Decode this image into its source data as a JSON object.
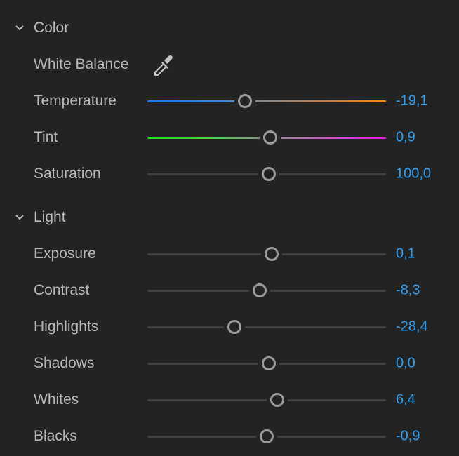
{
  "sections": [
    {
      "title": "Color",
      "icon": "chevron-down-icon",
      "white_balance": {
        "label": "White Balance",
        "icon": "eyedropper-icon"
      },
      "sliders": [
        {
          "label": "Temperature",
          "value": "-19,1",
          "position": 0.41,
          "track": "temperature-gradient"
        },
        {
          "label": "Tint",
          "value": "0,9",
          "position": 0.515,
          "track": "tint-gradient"
        },
        {
          "label": "Saturation",
          "value": "100,0",
          "position": 0.51,
          "track": "neutral"
        }
      ]
    },
    {
      "title": "Light",
      "icon": "chevron-down-icon",
      "sliders": [
        {
          "label": "Exposure",
          "value": "0,1",
          "position": 0.52,
          "track": "neutral"
        },
        {
          "label": "Contrast",
          "value": "-8,3",
          "position": 0.47,
          "track": "neutral"
        },
        {
          "label": "Highlights",
          "value": "-28,4",
          "position": 0.365,
          "track": "neutral"
        },
        {
          "label": "Shadows",
          "value": "0,0",
          "position": 0.51,
          "track": "neutral"
        },
        {
          "label": "Whites",
          "value": "6,4",
          "position": 0.545,
          "track": "neutral"
        },
        {
          "label": "Blacks",
          "value": "-0,9",
          "position": 0.5,
          "track": "neutral"
        }
      ]
    }
  ],
  "colors": {
    "background": "#232323",
    "value_text": "#2f9ff2",
    "label_text": "#b7b7b7",
    "knob": "#9a9a9a",
    "neutral_track": "#3f3f3f",
    "temperature_start": "#1e78e6",
    "temperature_end": "#f58a18",
    "tint_start": "#19e219",
    "tint_end": "#ee1ee6"
  }
}
